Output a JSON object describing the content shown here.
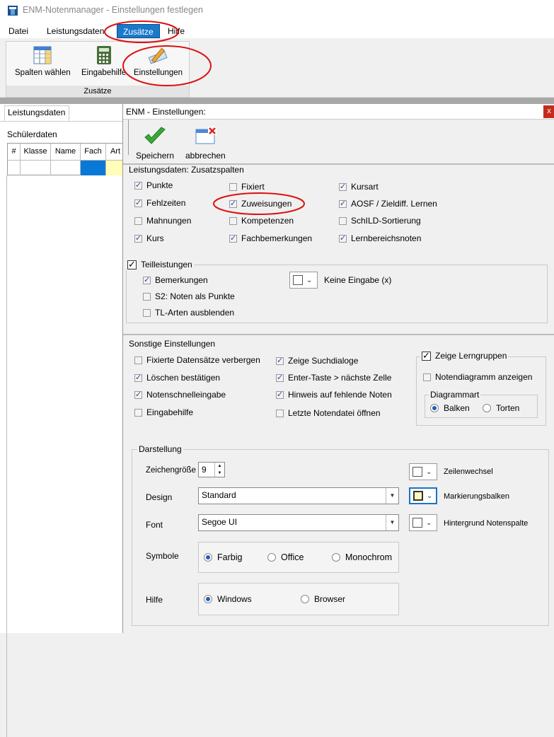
{
  "window": {
    "title": "ENM-Notenmanager - Einstellungen festlegen"
  },
  "menu": {
    "items": [
      "Datei",
      "Leistungsdaten",
      "Zusätze",
      "Hilfe"
    ]
  },
  "ribbon": {
    "buttons": [
      "Spalten wählen",
      "Eingabehilfe",
      "Einstellungen"
    ],
    "group_label": "Zusätze"
  },
  "left_pane": {
    "tab": "Leistungsdaten",
    "group_label": "Schülerdaten",
    "columns": [
      "#",
      "Klasse",
      "Name",
      "Fach",
      "Art"
    ]
  },
  "dialog": {
    "title": "ENM - Einstellungen:",
    "close": "x",
    "toolbar": {
      "save": "Speichern",
      "cancel": "abbrechen"
    },
    "zusatz": {
      "label": "Leistungsdaten: Zusatzspalten",
      "items": [
        {
          "label": "Punkte",
          "checked": true
        },
        {
          "label": "Fehlzeiten",
          "checked": true
        },
        {
          "label": "Mahnungen",
          "checked": false
        },
        {
          "label": "Kurs",
          "checked": true
        },
        {
          "label": "Fixiert",
          "checked": false
        },
        {
          "label": "Zuweisungen",
          "checked": true
        },
        {
          "label": "Kompetenzen",
          "checked": false
        },
        {
          "label": "Fachbemerkungen",
          "checked": true
        },
        {
          "label": "Kursart",
          "checked": true
        },
        {
          "label": "AOSF / Zieldiff. Lernen",
          "checked": true
        },
        {
          "label": "SchILD-Sortierung",
          "checked": false
        },
        {
          "label": "Lernbereichsnoten",
          "checked": true
        }
      ]
    },
    "teil": {
      "label": "Teilleistungen",
      "checked": true,
      "items": [
        {
          "label": "Bemerkungen",
          "checked": true
        },
        {
          "label": "S2: Noten als Punkte",
          "checked": false
        },
        {
          "label": "TL-Arten ausblenden",
          "checked": false
        }
      ],
      "color_label": "Keine Eingabe (x)"
    },
    "sonstige": {
      "label": "Sonstige Einstellungen",
      "items": [
        {
          "label": "Fixierte Datensätze verbergen",
          "checked": false
        },
        {
          "label": "Löschen bestätigen",
          "checked": true
        },
        {
          "label": "Notenschnelleingabe",
          "checked": true
        },
        {
          "label": "Eingabehilfe",
          "checked": false
        },
        {
          "label": "Zeige Suchdialoge",
          "checked": true
        },
        {
          "label": "Enter-Taste > nächste Zelle",
          "checked": true
        },
        {
          "label": "Hinweis auf fehlende Noten",
          "checked": true
        },
        {
          "label": "Letzte Notendatei öffnen",
          "checked": false
        }
      ],
      "lerngruppen": {
        "label": "Zeige Lerngruppen",
        "checked": true,
        "notendiagramm": {
          "label": "Notendiagramm anzeigen",
          "checked": false
        },
        "diagrammart": {
          "label": "Diagrammart",
          "options": [
            "Balken",
            "Torten"
          ],
          "selected": "Balken"
        }
      }
    },
    "darstellung": {
      "label": "Darstellung",
      "font_size_label": "Zeichengröße",
      "font_size": "9",
      "design_label": "Design",
      "design_value": "Standard",
      "font_label": "Font",
      "font_value": "Segoe UI",
      "symbols_label": "Symbole",
      "symbols_options": [
        "Farbig",
        "Office",
        "Monochrom"
      ],
      "symbols_selected": "Farbig",
      "help_label": "Hilfe",
      "help_options": [
        "Windows",
        "Browser"
      ],
      "help_selected": "Windows",
      "colors": [
        {
          "label": "Zeilenwechsel",
          "color": "#ffffff"
        },
        {
          "label": "Markierungsbalken",
          "color": "#fff7c0"
        },
        {
          "label": "Hintergrund Notenspalte",
          "color": "#ffffff"
        }
      ]
    }
  }
}
